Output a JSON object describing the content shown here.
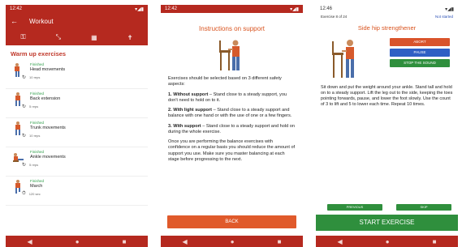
{
  "status": {
    "time1": "12:42",
    "time2": "12:42",
    "time3": "12:46"
  },
  "workout": {
    "title": "Workout",
    "section": "Warm up exercises",
    "items": [
      {
        "status": "Finished",
        "name": "Head movements",
        "meta": "10 reps"
      },
      {
        "status": "Finished",
        "name": "Back extension",
        "meta": "5 reps"
      },
      {
        "status": "Finished",
        "name": "Trunk movements",
        "meta": "10 reps"
      },
      {
        "status": "Finished",
        "name": "Ankle movements",
        "meta": "5 reps"
      },
      {
        "status": "Finished",
        "name": "March",
        "meta": "120 sec"
      }
    ]
  },
  "support": {
    "title": "Instructions on support",
    "intro": "Exercises should be selected based on 3 different safety aspects:",
    "p1_bold": "1. Without support",
    "p1": " – Stand close to a steady support, you don't need to hold on to it.",
    "p2_bold": "2. With light support",
    "p2": " – Stand close to a steady support and balance with one hand or with the use of one or a few fingers.",
    "p3_bold": "3. With support",
    "p3": " – Stand close to a steady support and hold on during the whole exercise.",
    "outro": "Once you are performing the balance exercises with confidence on a regular basis you should reduce the amount of support you use. Make sure you master balancing at each stage before progressing to the next.",
    "back": "BACK"
  },
  "exercise": {
    "counter": "Exercise 8 of 24",
    "state": "Not started",
    "title": "Side hip strengthener",
    "abort": "ABORT",
    "pause": "PAUSE",
    "stop_sound": "STOP THE SOUND",
    "description": "Sit down and put the weight around your ankle. Stand tall and hold on to a steady support. Lift the leg out to the side, keeping the toes pointing forwards, pause, and lower the foot slowly. Use the count of 3 to lift and 5 to lower each time. Repeat 10 times.",
    "previous": "PREVIOUS",
    "skip": "SKIP",
    "start": "START EXERCISE"
  },
  "icons": {
    "back": "arrow-left-icon",
    "dumbbell": "dumbbell-icon",
    "expand": "expand-icon",
    "calendar": "calendar-icon",
    "person": "person-icon",
    "nav_back": "nav-back-icon",
    "nav_home": "nav-home-icon",
    "nav_recent": "nav-recent-icon"
  },
  "colors": {
    "primary": "#b5291f",
    "accent": "#d9531e",
    "green": "#2f8f3d",
    "blue": "#2f5fc4"
  }
}
